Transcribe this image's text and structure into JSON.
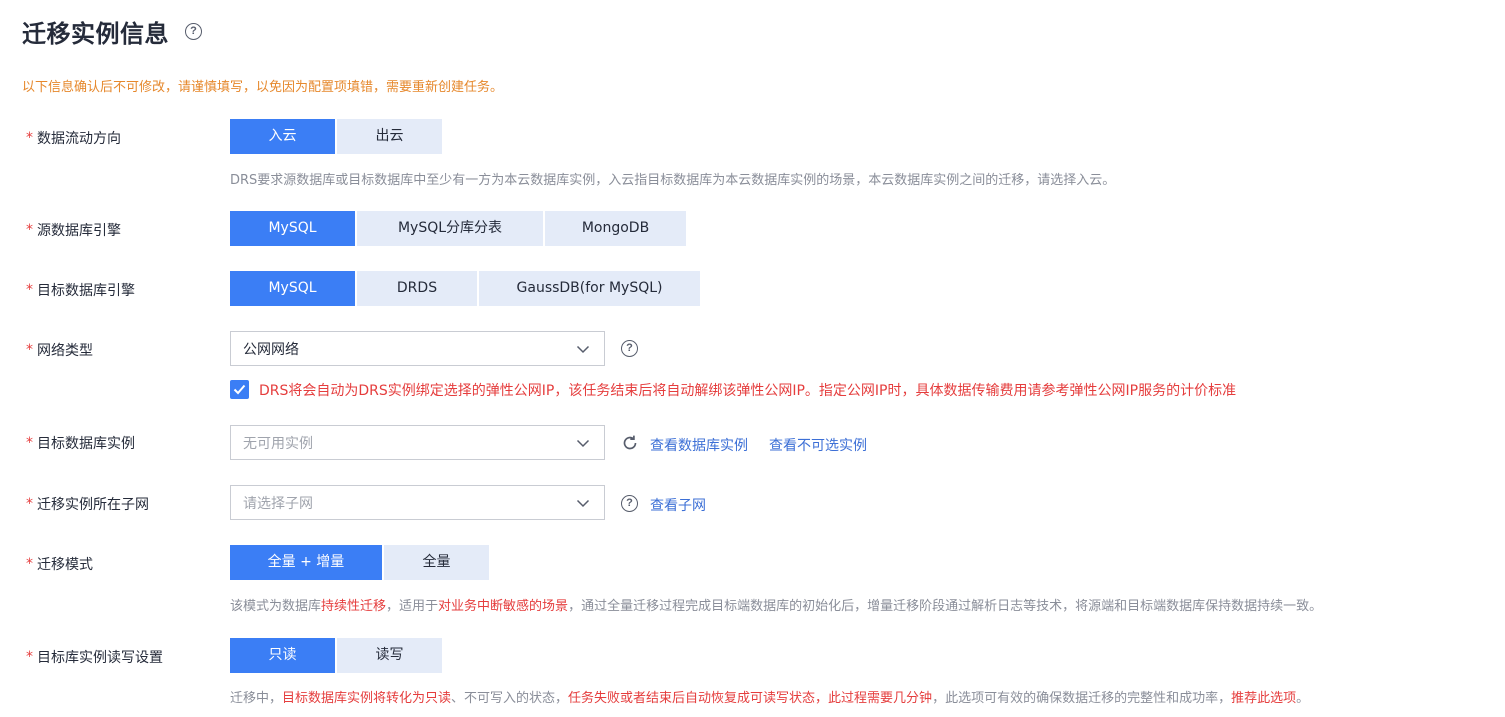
{
  "page": {
    "title": "迁移实例信息",
    "help_glyph": "?"
  },
  "warning": "以下信息确认后不可修改，请谨慎填写，以免因为配置项填错，需要重新创建任务。",
  "required_mark": "*",
  "flow_direction": {
    "label": "数据流动方向",
    "options": [
      "入云",
      "出云"
    ],
    "selected": "入云",
    "desc": "DRS要求源数据库或目标数据库中至少有一方为本云数据库实例，入云指目标数据库为本云数据库实例的场景，本云数据库实例之间的迁移，请选择入云。"
  },
  "source_engine": {
    "label": "源数据库引擎",
    "options": [
      "MySQL",
      "MySQL分库分表",
      "MongoDB"
    ],
    "selected": "MySQL"
  },
  "target_engine": {
    "label": "目标数据库引擎",
    "options": [
      "MySQL",
      "DRDS",
      "GaussDB(for MySQL)"
    ],
    "selected": "MySQL"
  },
  "network_type": {
    "label": "网络类型",
    "value": "公网网络",
    "checkbox_checked": true,
    "checkbox_text": "DRS将会自动为DRS实例绑定选择的弹性公网IP，该任务结束后将自动解绑该弹性公网IP。指定公网IP时，具体数据传输费用请参考弹性公网IP服务的计价标准"
  },
  "target_instance": {
    "label": "目标数据库实例",
    "placeholder": "无可用实例",
    "link_view": "查看数据库实例",
    "link_unselectable": "查看不可选实例"
  },
  "subnet": {
    "label": "迁移实例所在子网",
    "placeholder": "请选择子网",
    "link_view": "查看子网"
  },
  "migration_mode": {
    "label": "迁移模式",
    "options": [
      "全量 + 增量",
      "全量"
    ],
    "selected": "全量 + 增量",
    "desc_parts": [
      "该模式为数据库",
      "持续性迁移",
      "，适用于",
      "对业务中断敏感的场景",
      "，通过全量迁移过程完成目标端数据库的初始化后，增量迁移阶段通过解析日志等技术，将源端和目标端数据库保持数据持续一致。"
    ]
  },
  "rw_setting": {
    "label": "目标库实例读写设置",
    "options": [
      "只读",
      "读写"
    ],
    "selected": "只读",
    "desc_parts": [
      "迁移中，",
      "目标数据库实例将转化为只读",
      "、不可写入的状态，",
      "任务失败或者结束后自动恢复成可读写状态，此过程需要几分钟",
      "，此选项可有效的确保数据迁移的完整性和成功率，",
      "推荐此选项",
      "。"
    ]
  },
  "colors": {
    "primary": "#3b7ef5",
    "segment_bg": "#e4ebf8",
    "warning": "#e6882c",
    "danger": "#e53d3d",
    "link": "#3c6fd6"
  },
  "icons": [
    "question-circle-icon",
    "chevron-down-icon",
    "check-icon",
    "refresh-icon"
  ]
}
